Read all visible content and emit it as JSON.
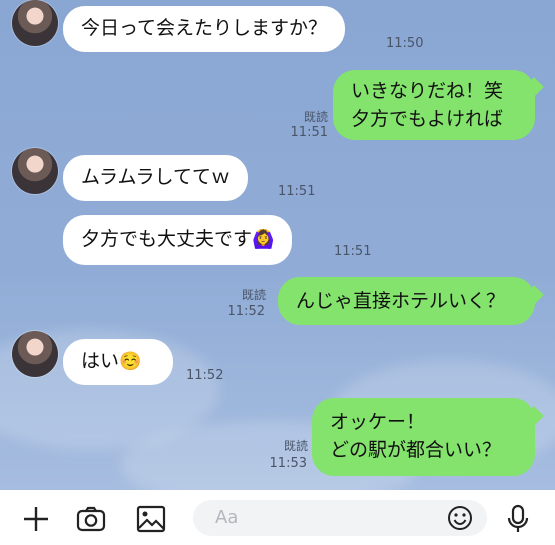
{
  "messages": [
    {
      "dir": "in",
      "text": "今日って会えたりしますか？",
      "time": "11:50"
    },
    {
      "dir": "out",
      "lines": [
        "いきなりだね！笑",
        "夕方でもよければ"
      ],
      "read": "既読",
      "time": "11:51"
    },
    {
      "dir": "in",
      "text": "ムラムラしててｗ",
      "time": "11:51"
    },
    {
      "dir": "in",
      "text": "夕方でも大丈夫です",
      "emoji": "🙆‍♀️",
      "time": "11:51"
    },
    {
      "dir": "out",
      "text": "んじゃ直接ホテルいく？",
      "read": "既読",
      "time": "11:52"
    },
    {
      "dir": "in",
      "text": "はい",
      "emoji": "☺️",
      "time": "11:52"
    },
    {
      "dir": "out",
      "lines": [
        "オッケー！",
        "どの駅が都合いい？"
      ],
      "read": "既読",
      "time": "11:53"
    }
  ],
  "input": {
    "placeholder": "Aa"
  },
  "icons": {
    "add": "plus-icon",
    "camera": "camera-icon",
    "image": "image-icon",
    "emoji": "smiley-icon",
    "mic": "microphone-icon"
  },
  "colors": {
    "outgoing": "#84e36d",
    "incoming": "#ffffff",
    "background": "#8ea9d3"
  }
}
